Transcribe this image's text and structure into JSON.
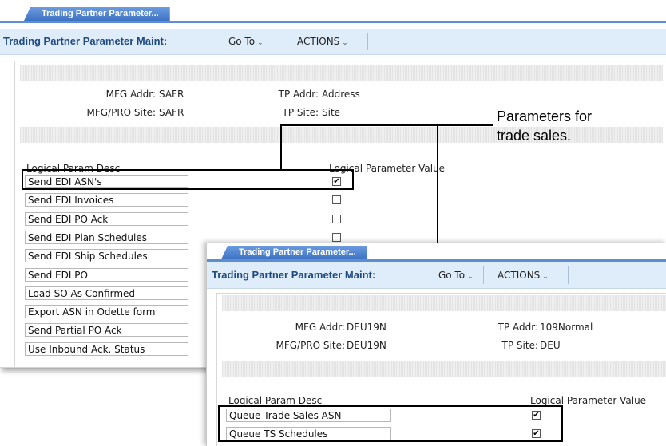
{
  "window1": {
    "tab_label": "Trading Partner Parameter...",
    "toolbar": {
      "title": "Trading Partner Parameter Maint:",
      "goto": "Go To",
      "actions": "ACTIONS"
    },
    "fields": {
      "mfg_addr_label": "MFG Addr:",
      "mfg_addr_value": "SAFR",
      "mfg_site_label": "MFG/PRO Site:",
      "mfg_site_value": "SAFR",
      "tp_addr_label": "TP Addr:",
      "tp_addr_value": "Address",
      "tp_site_label": "TP Site:",
      "tp_site_value": "Site"
    },
    "col_desc": "Logical Param Desc",
    "col_value": "Logical Parameter Value",
    "rows": [
      {
        "label": "Send EDI ASN's",
        "checked": true
      },
      {
        "label": "Send EDI Invoices",
        "checked": false
      },
      {
        "label": "Send EDI PO Ack",
        "checked": false
      },
      {
        "label": "Send EDI Plan Schedules",
        "checked": false
      },
      {
        "label": "Send EDI Ship Schedules",
        "checked": false
      },
      {
        "label": "Send EDI PO",
        "checked": false
      },
      {
        "label": "Load SO As Confirmed",
        "checked": false
      },
      {
        "label": "Export ASN in Odette form",
        "checked": false
      },
      {
        "label": "Send Partial PO Ack",
        "checked": false
      },
      {
        "label": "Use Inbound Ack. Status",
        "checked": false
      }
    ]
  },
  "window2": {
    "tab_label": "Trading Partner Parameter...",
    "toolbar": {
      "title": "Trading Partner Parameter Maint:",
      "goto": "Go To",
      "actions": "ACTIONS"
    },
    "fields": {
      "mfg_addr_label": "MFG Addr:",
      "mfg_addr_value": "DEU19N",
      "mfg_site_label": "MFG/PRO Site:",
      "mfg_site_value": "DEU19N",
      "tp_addr_label": "TP Addr:",
      "tp_addr_value": "109Normal",
      "tp_site_label": "TP Site:",
      "tp_site_value": "DEU"
    },
    "col_desc": "Logical Param Desc",
    "col_value": "Logical Parameter Value",
    "rows": [
      {
        "label": "Queue Trade Sales ASN",
        "checked": true
      },
      {
        "label": "Queue TS Schedules",
        "checked": true
      }
    ]
  },
  "callout": {
    "line1": "Parameters for",
    "line2": "trade sales."
  },
  "colors": {
    "tab": "#3d72c3",
    "toolbar_bg": "#dfecfa",
    "title_text": "#204a82"
  }
}
